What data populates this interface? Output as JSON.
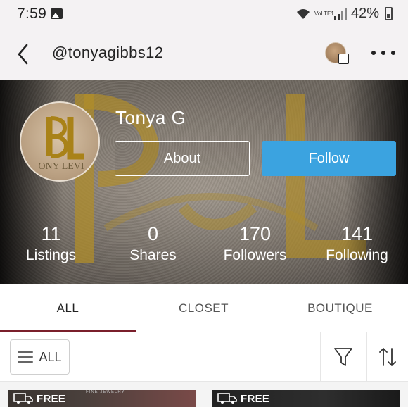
{
  "status_bar": {
    "time": "7:59",
    "volte": "VoLTE1",
    "battery": "42%"
  },
  "nav": {
    "title": "@tonyagibbs12"
  },
  "profile": {
    "name": "Tonya G",
    "about_label": "About",
    "follow_label": "Follow",
    "follow_color": "#3ba3e0",
    "avatar_text": "ONY LEVI"
  },
  "stats": [
    {
      "value": "11",
      "label": "Listings"
    },
    {
      "value": "0",
      "label": "Shares"
    },
    {
      "value": "170",
      "label": "Followers"
    },
    {
      "value": "141",
      "label": "Following"
    }
  ],
  "tabs": [
    {
      "label": "ALL",
      "active": true
    },
    {
      "label": "CLOSET",
      "active": false
    },
    {
      "label": "BOUTIQUE",
      "active": false
    }
  ],
  "accent_color": "#7a1f2b",
  "filters": {
    "all_label": "ALL",
    "icons": [
      "menu-icon",
      "funnel-icon",
      "sort-icon"
    ]
  },
  "listings": [
    {
      "badge": "FREE",
      "caption": "FINE JEWELRY"
    },
    {
      "badge": "FREE"
    }
  ]
}
